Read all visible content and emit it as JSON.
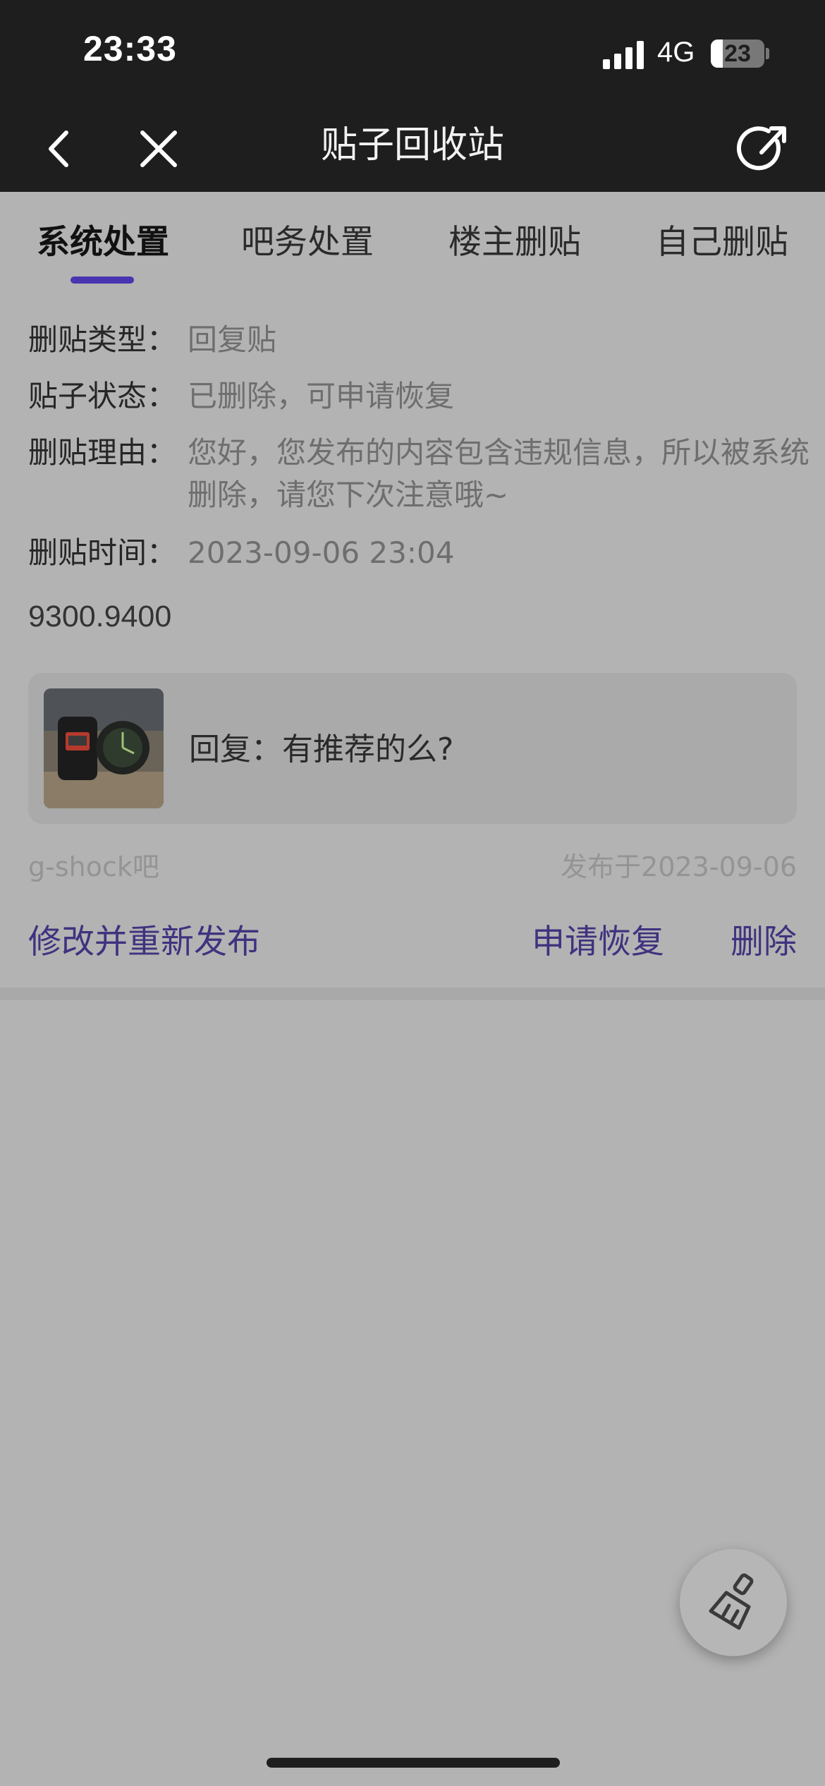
{
  "status_bar": {
    "time": "23:33",
    "network": "4G",
    "battery": "23",
    "battery_level": 0.23
  },
  "nav": {
    "title": "贴子回收站",
    "icons": [
      "chevron-left-icon",
      "close-icon",
      "share-icon"
    ]
  },
  "tabs": [
    {
      "label": "系统处置",
      "active": true
    },
    {
      "label": "吧务处置",
      "active": false
    },
    {
      "label": "楼主删贴",
      "active": false
    },
    {
      "label": "自己删贴",
      "active": false
    }
  ],
  "detail": {
    "type_label": "删贴类型：",
    "type_value": "回复贴",
    "status_label": "贴子状态：",
    "status_value": "已删除，可申请恢复",
    "reason_label": "删贴理由：",
    "reason_value": "您好，您发布的内容包含违规信息，所以被系统删除，请您下次注意哦~",
    "time_label": "删贴时间：",
    "time_value": "2023-09-06 23:04"
  },
  "code": "9300.9400",
  "post": {
    "title": "回复：有推荐的么?",
    "forum": "g-shock吧",
    "published": "发布于2023-09-06"
  },
  "actions": {
    "edit_republish": "修改并重新发布",
    "apply_restore": "申请恢复",
    "delete": "删除"
  },
  "colors": {
    "accent": "#4a35b0",
    "action_text": "#40327f",
    "header_bg": "#1e1e1f",
    "overlay_bg": "#b3b3b3"
  },
  "fab": {
    "icon": "broom-icon"
  }
}
